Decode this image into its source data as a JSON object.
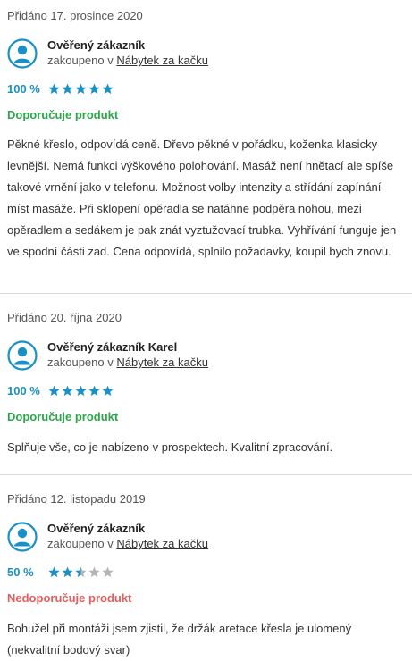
{
  "reviews": [
    {
      "added": "Přidáno 17. prosince 2020",
      "user": "Ověřený zákazník",
      "bought_prefix": "zakoupeno v",
      "shop": "Nábytek za kačku",
      "score_text": "100 %",
      "score_value": 1.0,
      "recommendation": "Doporučuje produkt",
      "recommendation_color": "#2ba84a",
      "text": "Pěkné křeslo, odpovídá ceně. Dřevo pěkné v pořádku, koženka klasicky levnější. Nemá funkci výškového polohování. Masáž není hnětací ale spíše takové vrnění jako v telefonu. Možnost volby intenzity a střídání zapínání míst masáže. Při sklopení opěradla se natáhne podpěra nohou, mezi opěradlem a sedákem je pak znát vyztužovací trubka. Vyhřívání funguje jen ve spodní části zad. Cena odpovídá, splnilo požadavky, koupil bych znovu."
    },
    {
      "added": "Přidáno 20. října 2020",
      "user": "Ověřený zákazník Karel",
      "bought_prefix": "zakoupeno v",
      "shop": "Nábytek za kačku",
      "score_text": "100 %",
      "score_value": 1.0,
      "recommendation": "Doporučuje produkt",
      "recommendation_color": "#2ba84a",
      "text": "Splňuje vše, co je nabízeno v prospektech. Kvalitní zpracování."
    },
    {
      "added": "Přidáno 12. listopadu 2019",
      "user": "Ověřený zákazník",
      "bought_prefix": "zakoupeno v",
      "shop": "Nábytek za kačku",
      "score_text": "50 %",
      "score_value": 0.5,
      "recommendation": "Nedoporučuje produkt",
      "recommendation_color": "#e85c5c",
      "text": "Bohužel při montáži jsem zjistil, že držák aretace křesla je ulomený (nekvalitní bodový svar)"
    }
  ],
  "colors": {
    "accent": "#1a90c7",
    "star_empty": "#b5b5b5"
  },
  "icons": {
    "avatar": "user-avatar-icon",
    "star": "star-icon"
  }
}
